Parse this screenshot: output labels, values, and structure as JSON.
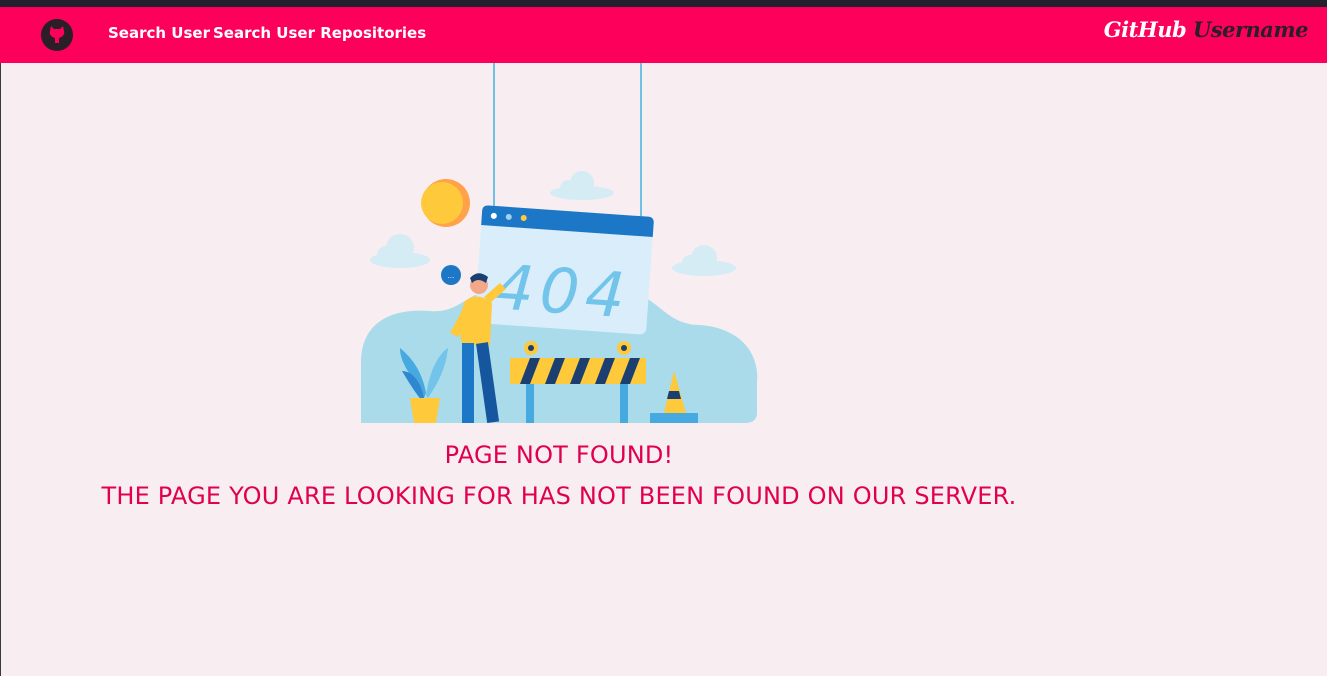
{
  "nav": {
    "links": [
      "Search User",
      "Search User Repositories"
    ],
    "brand": {
      "part1": "GitHub",
      "part2": "Username"
    }
  },
  "error": {
    "illustration_text": "404",
    "title": "PAGE NOT FOUND!",
    "message": "THE PAGE YOU ARE LOOKING FOR HAS NOT BEEN FOUND ON OUR SERVER."
  },
  "colors": {
    "navbar": "#fc005c",
    "background": "#f8eef1",
    "accent_text": "#e0004f",
    "logo": "#2a1f26"
  },
  "icons": {
    "logo": "github-logo-icon"
  }
}
